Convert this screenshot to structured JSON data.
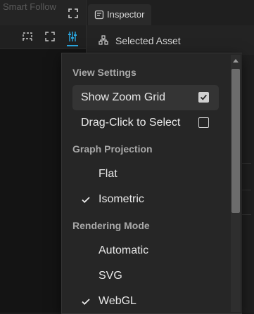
{
  "editor": {
    "faded_title": "Smart Follow"
  },
  "inspector": {
    "tab_label": "Inspector",
    "header_label": "Selected Asset"
  },
  "menu": {
    "view_settings": {
      "title": "View Settings",
      "items": [
        {
          "label": "Show Zoom Grid",
          "checked": true
        },
        {
          "label": "Drag-Click to Select",
          "checked": false
        }
      ]
    },
    "graph_projection": {
      "title": "Graph Projection",
      "options": [
        {
          "label": "Flat",
          "selected": false
        },
        {
          "label": "Isometric",
          "selected": true
        }
      ]
    },
    "rendering_mode": {
      "title": "Rendering Mode",
      "options": [
        {
          "label": "Automatic",
          "selected": false
        },
        {
          "label": "SVG",
          "selected": false
        },
        {
          "label": "WebGL",
          "selected": true
        }
      ]
    }
  },
  "icons": {
    "expand": "expand-icon",
    "select_region": "select-region-icon",
    "fit_view": "fit-view-icon",
    "view_settings": "sliders-icon",
    "inspector": "inspector-icon",
    "asset": "hierarchy-icon",
    "check": "check-icon"
  },
  "colors": {
    "accent": "#2aa7e0",
    "menu_bg": "#262626",
    "hover_row": "#343434"
  }
}
